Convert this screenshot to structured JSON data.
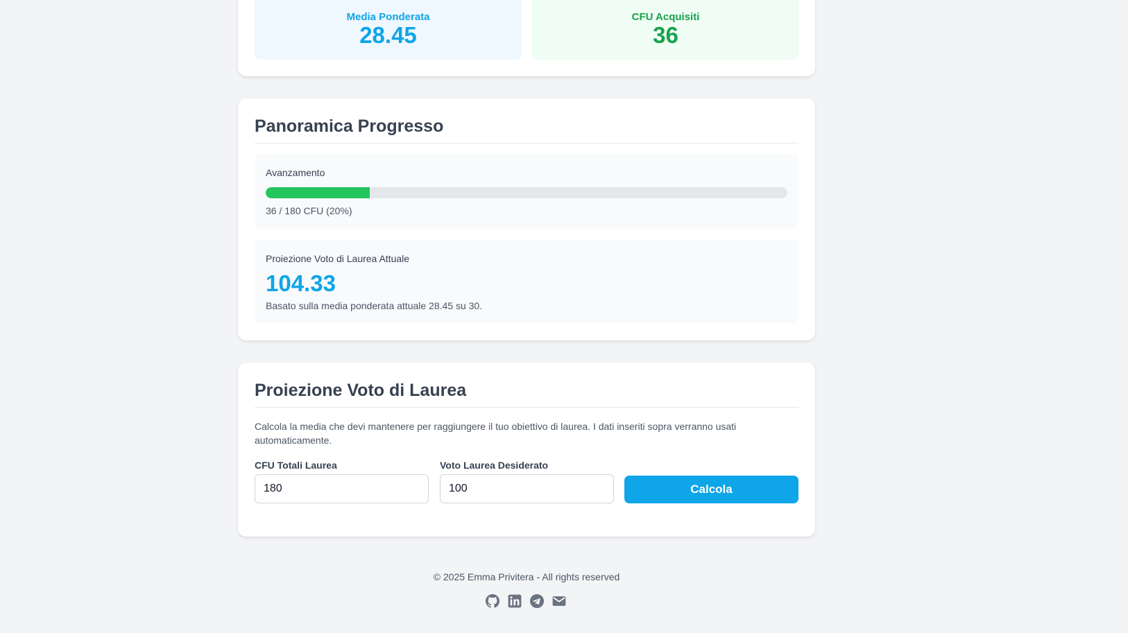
{
  "stats": {
    "media_label": "Media Ponderata",
    "media_value": "28.45",
    "cfu_label": "CFU Acquisiti",
    "cfu_value": "36"
  },
  "progress": {
    "title": "Panoramica Progresso",
    "advancement_label": "Avanzamento",
    "fraction": 0.2,
    "summary": "36 / 180 CFU (20%)",
    "projection_label": "Proiezione Voto di Laurea Attuale",
    "projection_value": "104.33",
    "projection_note": "Basato sulla media ponderata attuale 28.45 su 30."
  },
  "calculator": {
    "title": "Proiezione Voto di Laurea",
    "description": "Calcola la media che devi mantenere per raggiungere il tuo obiettivo di laurea. I dati inseriti sopra verranno usati automaticamente.",
    "cfu_total_label": "CFU Totali Laurea",
    "cfu_total_value": "180",
    "target_grade_label": "Voto Laurea Desiderato",
    "target_grade_value": "100",
    "button_label": "Calcola"
  },
  "footer": {
    "copyright": "© 2025 Emma Privitera - All rights reserved",
    "icons": [
      "github-icon",
      "linkedin-icon",
      "telegram-icon",
      "email-icon"
    ]
  },
  "colors": {
    "accent_blue": "#0ea5e9",
    "accent_green": "#22c55e",
    "text_green": "#16a34a",
    "background": "#f3f4f6",
    "icon_gray": "#6b7280"
  }
}
